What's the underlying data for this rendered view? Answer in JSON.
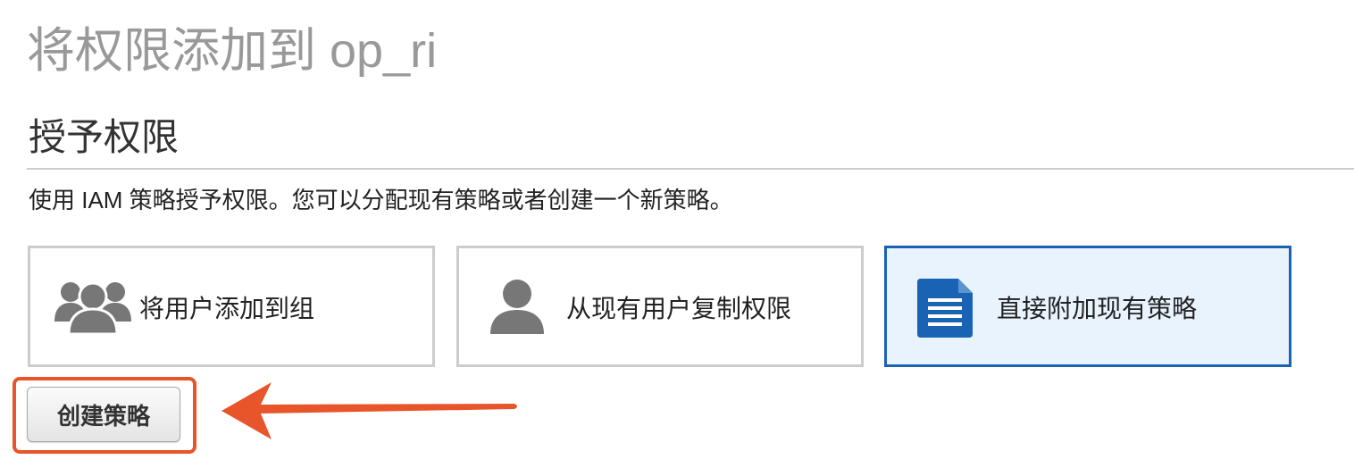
{
  "header": {
    "page_title": "将权限添加到 op_ri"
  },
  "section": {
    "title": "授予权限",
    "description": "使用 IAM 策略授予权限。您可以分配现有策略或者创建一个新策略。"
  },
  "options": [
    {
      "label": "将用户添加到组",
      "icon": "user-group-icon",
      "selected": false
    },
    {
      "label": "从现有用户复制权限",
      "icon": "user-icon",
      "selected": false
    },
    {
      "label": "直接附加现有策略",
      "icon": "document-icon",
      "selected": true
    }
  ],
  "actions": {
    "create_policy_label": "创建策略"
  },
  "colors": {
    "selected_border": "#1a63b4",
    "selected_background": "#e8f3fd",
    "annotation": "#e8552a",
    "icon_gray": "#777777",
    "document_blue": "#1a63b4"
  }
}
